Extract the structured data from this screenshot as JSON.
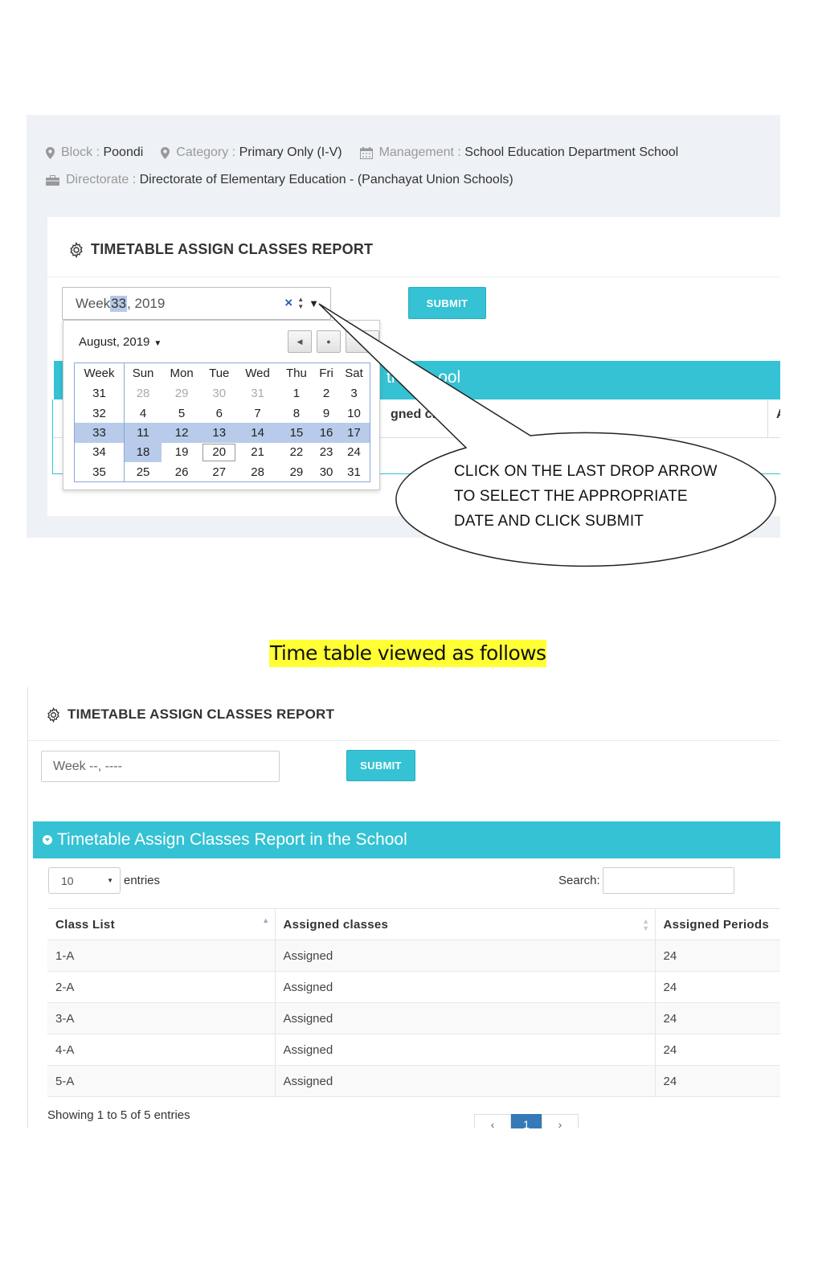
{
  "info": {
    "block_label": "Block :",
    "block_value": "Poondi",
    "category_label": "Category :",
    "category_value": "Primary Only (I-V)",
    "management_label": "Management :",
    "management_value": "School Education Department School",
    "directorate_label": "Directorate :",
    "directorate_value": "Directorate of Elementary Education - (Panchayat Union Schools)"
  },
  "report_title": "TIMETABLE ASSIGN CLASSES REPORT",
  "top": {
    "week_prefix": "Week ",
    "week_number": "33",
    "week_suffix": ", 2019",
    "clear_symbol": "×",
    "submit_label": "SUBMIT",
    "band_fragment": "th        ool",
    "table_fragment": "ɡned clas",
    "table_fragment_right": "A"
  },
  "datepicker": {
    "month_label": "August, 2019",
    "headers": [
      "Week",
      "Sun",
      "Mon",
      "Tue",
      "Wed",
      "Thu",
      "Fri",
      "Sat"
    ],
    "rows": [
      {
        "week": "31",
        "days": [
          "28",
          "29",
          "30",
          "31",
          "1",
          "2",
          "3"
        ]
      },
      {
        "week": "32",
        "days": [
          "4",
          "5",
          "6",
          "7",
          "8",
          "9",
          "10"
        ]
      },
      {
        "week": "33",
        "days": [
          "11",
          "12",
          "13",
          "14",
          "15",
          "16",
          "17"
        ]
      },
      {
        "week": "34",
        "days": [
          "18",
          "19",
          "20",
          "21",
          "22",
          "23",
          "24"
        ]
      },
      {
        "week": "35",
        "days": [
          "25",
          "26",
          "27",
          "28",
          "29",
          "30",
          "31"
        ]
      }
    ]
  },
  "callout": {
    "line1": "CLICK ON THE LAST DROP ARROW",
    "line2": "TO SELECT THE APPROPRIATE",
    "line3": "DATE AND CLICK SUBMIT"
  },
  "caption": "Time table viewed as follows",
  "bottom": {
    "week_placeholder": "Week --, ----",
    "submit_label": "SUBMIT",
    "panel_title": "Timetable Assign Classes Report in the School",
    "entries_value": "10",
    "entries_label": "entries",
    "search_label": "Search:",
    "columns": [
      "Class List",
      "Assigned classes",
      "Assigned Periods"
    ],
    "rows": [
      {
        "class": "1-A",
        "status": "Assigned",
        "periods": "24"
      },
      {
        "class": "2-A",
        "status": "Assigned",
        "periods": "24"
      },
      {
        "class": "3-A",
        "status": "Assigned",
        "periods": "24"
      },
      {
        "class": "4-A",
        "status": "Assigned",
        "periods": "24"
      },
      {
        "class": "5-A",
        "status": "Assigned",
        "periods": "24"
      }
    ],
    "showing": "Showing 1 to 5 of 5 entries",
    "pager": [
      "‹",
      "1",
      "›"
    ]
  },
  "colors": {
    "accent_teal": "#34c2d4",
    "selection_blue": "#b8cbea",
    "caption_highlight": "#ffff33",
    "pager_active": "#337ab7"
  }
}
